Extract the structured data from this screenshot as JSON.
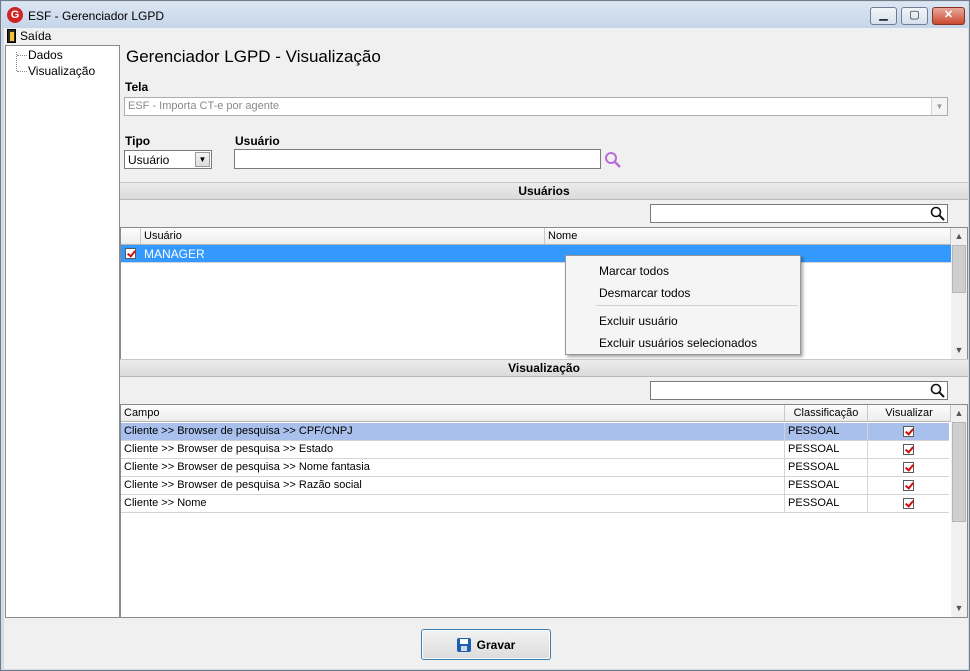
{
  "window": {
    "title": "ESF - Gerenciador LGPD",
    "logo_letter": "G",
    "min": "▁",
    "max": "▢",
    "close": "✕"
  },
  "menu": {
    "exit_label": "Saída"
  },
  "tree": {
    "items": [
      {
        "label": "Dados"
      },
      {
        "label": "Visualização"
      }
    ]
  },
  "main": {
    "title": "Gerenciador LGPD - Visualização",
    "tela_label": "Tela",
    "tela_value": "ESF - Importa CT-e por agente",
    "tipo_label": "Tipo",
    "tipo_value": "Usuário",
    "usuario_label": "Usuário",
    "usuario_value": ""
  },
  "users_section": {
    "title": "Usuários",
    "search_value": "",
    "columns": [
      "Usuário",
      "Nome"
    ],
    "rows": [
      {
        "usuario": "MANAGER",
        "nome": "",
        "checked": true
      }
    ]
  },
  "context_menu": {
    "items": [
      "Marcar todos",
      "Desmarcar todos",
      "Excluir usuário",
      "Excluir usuários selecionados"
    ]
  },
  "view_section": {
    "title": "Visualização",
    "search_value": "",
    "columns": [
      "Campo",
      "Classificação",
      "Visualizar"
    ],
    "rows": [
      {
        "campo": "Cliente >> Browser de pesquisa >> CPF/CNPJ",
        "classificacao": "PESSOAL",
        "visualizar": true
      },
      {
        "campo": "Cliente >> Browser de pesquisa >> Estado",
        "classificacao": "PESSOAL",
        "visualizar": true
      },
      {
        "campo": "Cliente >> Browser de pesquisa >> Nome fantasia",
        "classificacao": "PESSOAL",
        "visualizar": true
      },
      {
        "campo": "Cliente >> Browser de pesquisa >> Razão social",
        "classificacao": "PESSOAL",
        "visualizar": true
      },
      {
        "campo": "Cliente >> Nome",
        "classificacao": "PESSOAL",
        "visualizar": true
      }
    ]
  },
  "footer": {
    "save_label": "Gravar"
  },
  "colors": {
    "selection": "#3399ff",
    "row_highlight": "#a9c0ec",
    "accent": "#d02424"
  }
}
